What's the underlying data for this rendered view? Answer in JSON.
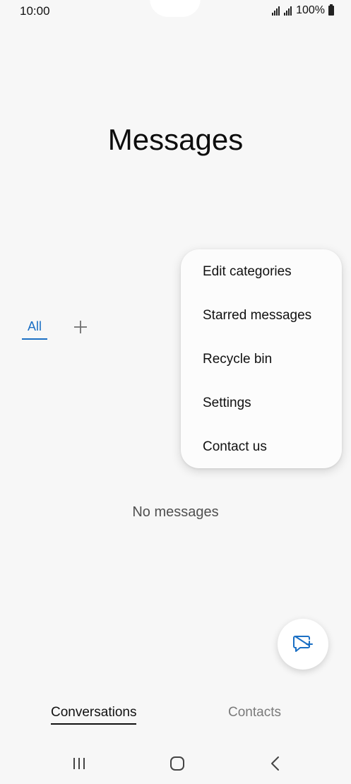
{
  "status_bar": {
    "time": "10:00",
    "battery": "100%"
  },
  "header": {
    "title": "Messages"
  },
  "categories": {
    "active_tab": "All"
  },
  "menu": {
    "items": [
      {
        "label": "Edit categories"
      },
      {
        "label": "Starred messages"
      },
      {
        "label": "Recycle bin"
      },
      {
        "label": "Settings"
      },
      {
        "label": "Contact us"
      }
    ]
  },
  "main": {
    "empty_text": "No messages"
  },
  "bottom_tabs": [
    {
      "label": "Conversations",
      "active": true
    },
    {
      "label": "Contacts",
      "active": false
    }
  ],
  "colors": {
    "accent": "#1a6fc4",
    "background": "#f7f7f7"
  },
  "icons": {
    "add_category": "plus-icon",
    "compose": "chat-bubble-plus-icon",
    "nav_recents": "recents-icon",
    "nav_home": "home-icon",
    "nav_back": "back-icon"
  }
}
